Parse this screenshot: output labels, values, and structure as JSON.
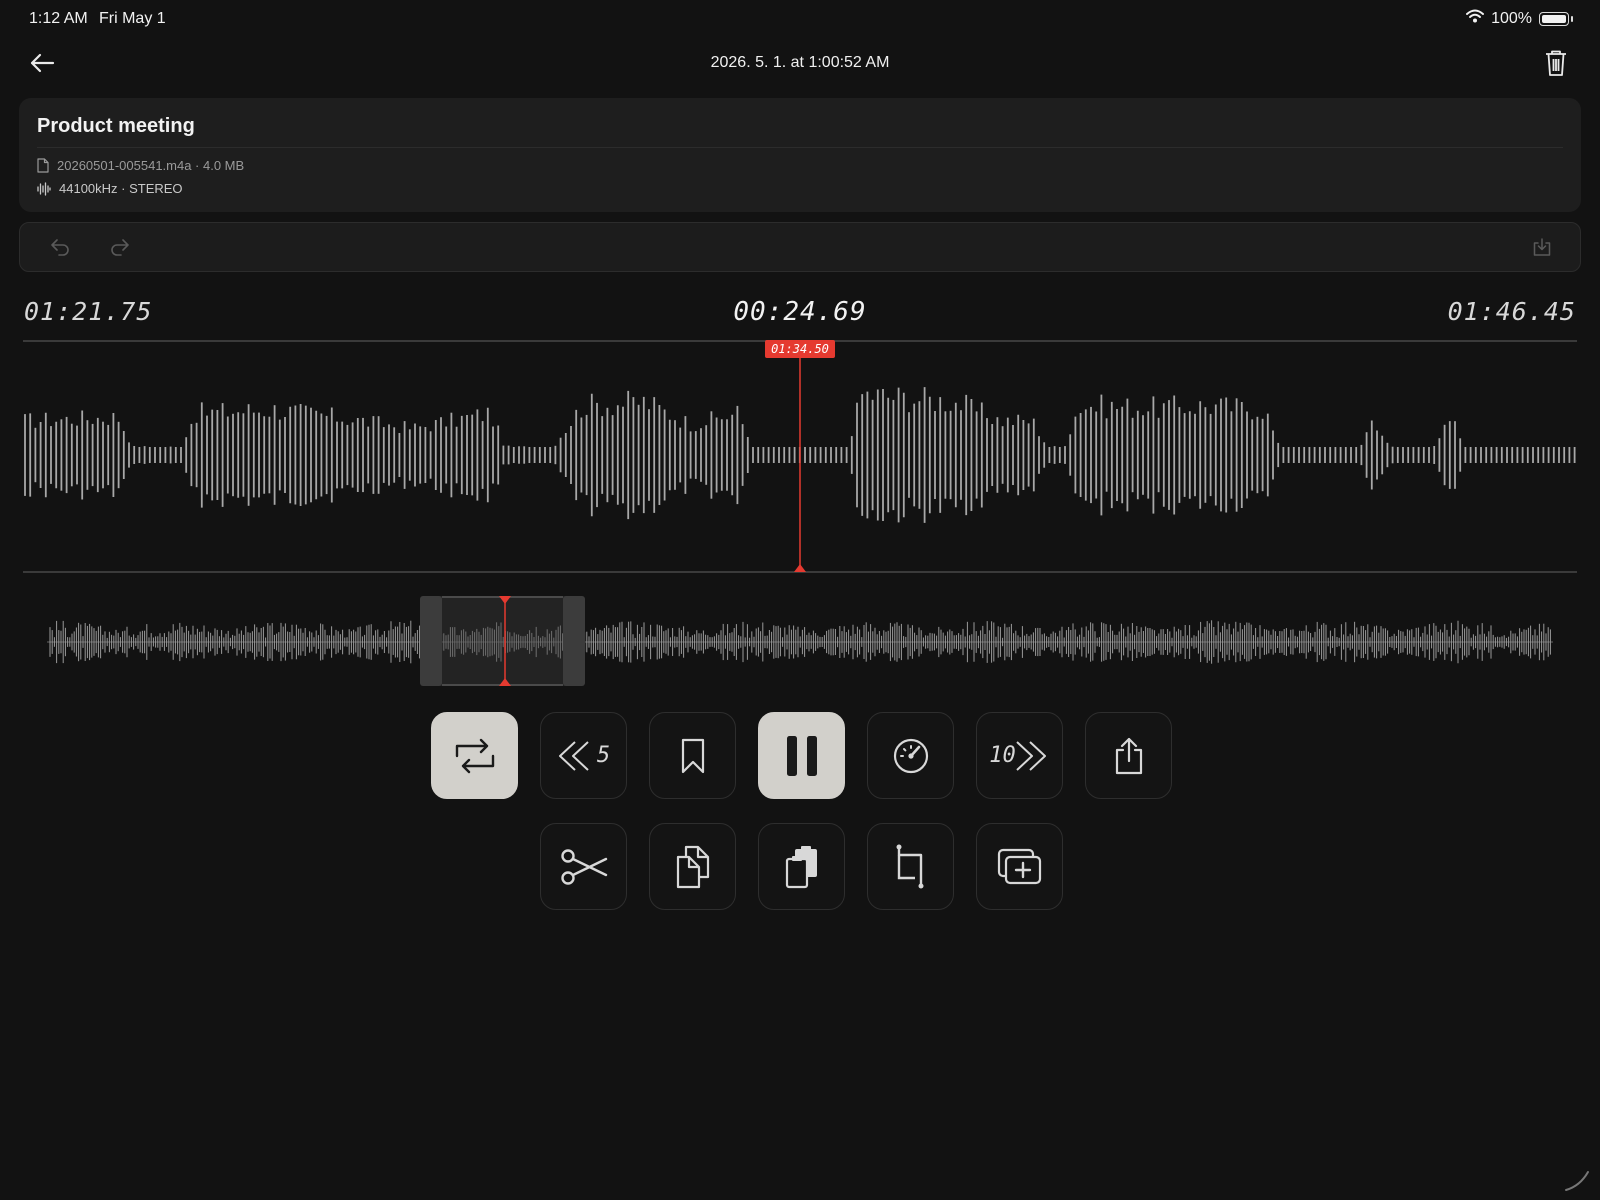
{
  "status": {
    "time": "1:12 AM",
    "date": "Fri May 1",
    "battery": "100%"
  },
  "nav": {
    "title": "2026. 5. 1. at 1:00:52 AM"
  },
  "recording": {
    "title": "Product meeting",
    "file": "20260501-005541.m4a · 4.0 MB",
    "audio": "44100kHz · STEREO"
  },
  "times": {
    "selection_start": "01:21.75",
    "current": "00:24.69",
    "selection_end": "01:46.45"
  },
  "playhead": {
    "label": "01:34.50"
  },
  "colors": {
    "accent": "#e53a30",
    "background": "#121212",
    "card": "#1e1e1e",
    "waveform": "#a8a8a8",
    "active_button": "#d2d0cb"
  },
  "controls": {
    "row1": [
      {
        "icon": "repeat-icon",
        "active": true
      },
      {
        "icon": "rewind-icon",
        "label": "5"
      },
      {
        "icon": "bookmark-icon"
      },
      {
        "icon": "pause-icon",
        "active": true
      },
      {
        "icon": "speed-gauge-icon"
      },
      {
        "icon": "forward-icon",
        "label": "10"
      },
      {
        "icon": "share-icon"
      }
    ],
    "row2": [
      {
        "icon": "scissors-icon"
      },
      {
        "icon": "copy-icon"
      },
      {
        "icon": "paste-icon"
      },
      {
        "icon": "crop-icon"
      },
      {
        "icon": "insert-icon"
      }
    ]
  }
}
